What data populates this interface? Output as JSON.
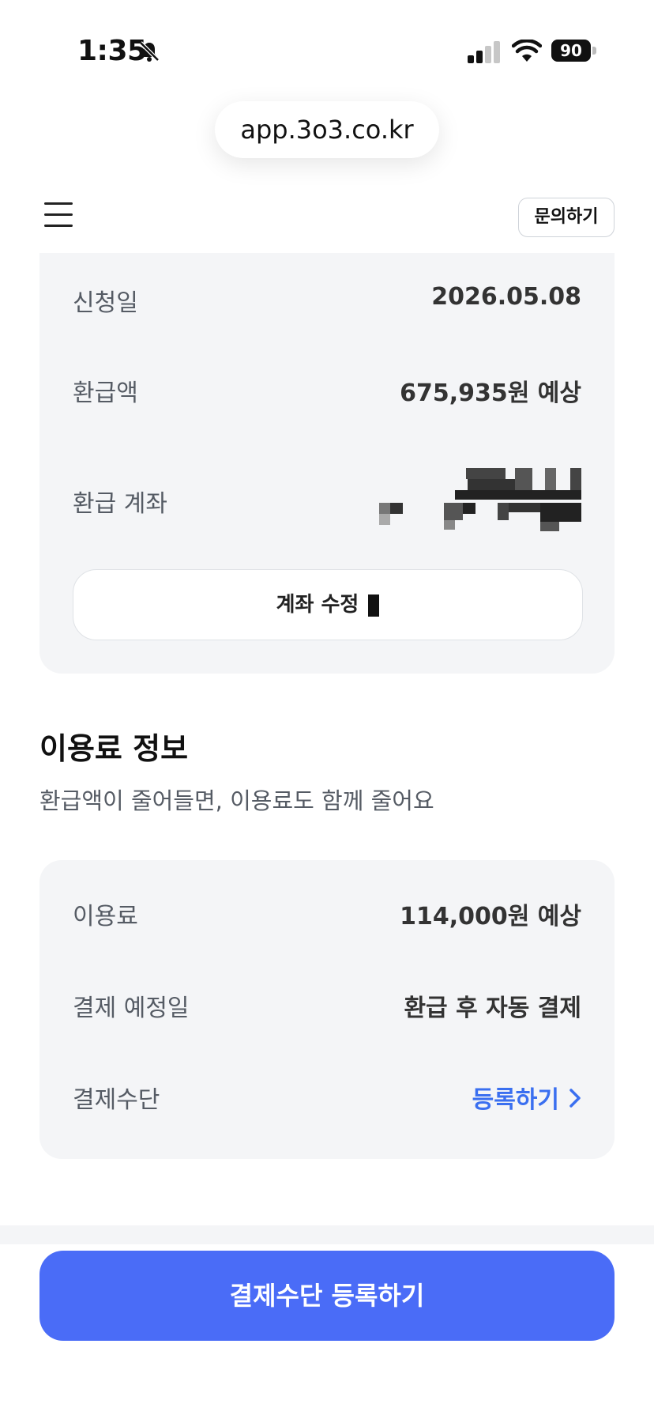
{
  "status_bar": {
    "time": "1:35",
    "battery": "90"
  },
  "browser": {
    "url": "app.3o3.co.kr"
  },
  "header": {
    "inquiry_label": "문의하기"
  },
  "refund_card": {
    "rows": [
      {
        "label": "신청일",
        "value": "2026.05.08"
      },
      {
        "label": "환급액",
        "value": "675,935원 예상"
      },
      {
        "label": "환급 계좌",
        "value": ""
      }
    ],
    "edit_button_label": "계좌 수정"
  },
  "fee_section": {
    "title": "이용료 정보",
    "subtitle": "환급액이 줄어들면, 이용료도 함께 줄어요",
    "rows": [
      {
        "label": "이용료",
        "value": "114,000원 예상"
      },
      {
        "label": "결제 예정일",
        "value": "환급 후 자동 결제"
      },
      {
        "label": "결제수단",
        "value": "등록하기"
      }
    ]
  },
  "cta": {
    "label": "결제수단 등록하기"
  },
  "colors": {
    "accent": "#4a6cf7",
    "link": "#3a6ff0",
    "card_bg": "#f4f5f7"
  }
}
